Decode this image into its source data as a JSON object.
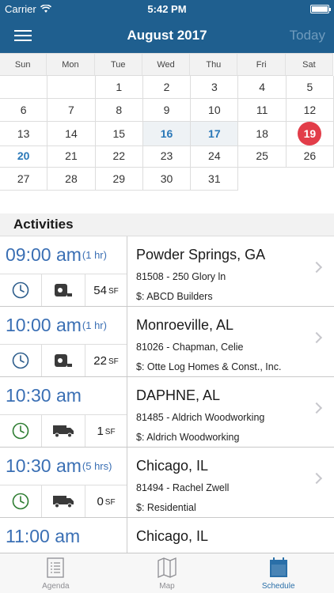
{
  "status": {
    "carrier": "Carrier",
    "time": "5:42 PM"
  },
  "nav": {
    "title": "August 2017",
    "today_label": "Today"
  },
  "calendar": {
    "weekdays": [
      "Sun",
      "Mon",
      "Tue",
      "Wed",
      "Thu",
      "Fri",
      "Sat"
    ],
    "weeks": [
      [
        "",
        "",
        "1",
        "2",
        "3",
        "4",
        "5"
      ],
      [
        "6",
        "7",
        "8",
        "9",
        "10",
        "11",
        "12"
      ],
      [
        "13",
        "14",
        "15",
        "16",
        "17",
        "18",
        "19"
      ],
      [
        "20",
        "21",
        "22",
        "23",
        "24",
        "25",
        "26"
      ],
      [
        "27",
        "28",
        "29",
        "30",
        "31",
        "",
        ""
      ]
    ],
    "highlighted_days": [
      "16",
      "17"
    ],
    "selected_day": "20",
    "today": "19",
    "today_color": "#e23d49",
    "accent_color": "#2a78b8"
  },
  "activities_header": "Activities",
  "activities": [
    {
      "time": "09:00 am",
      "duration": "(1 hr)",
      "icon_type": "tape-measure-icon",
      "quantity": "54",
      "unit": "SF",
      "city": "Powder Springs, GA",
      "job": "81508 - 250 Glory ln",
      "client": "$: ABCD Builders",
      "clock_color": "#2d5d8c"
    },
    {
      "time": "10:00 am",
      "duration": "(1 hr)",
      "icon_type": "tape-measure-icon",
      "quantity": "22",
      "unit": "SF",
      "city": "Monroeville, AL",
      "job": "81026 - Chapman, Celie",
      "client": "$: Otte Log Homes & Const., Inc.",
      "clock_color": "#2d5d8c"
    },
    {
      "time": "10:30 am",
      "duration": "",
      "icon_type": "truck-icon",
      "quantity": "1",
      "unit": "SF",
      "city": "DAPHNE, AL",
      "job": "81485 - Aldrich Woodworking",
      "client": "$: Aldrich Woodworking",
      "clock_color": "#2e7d32"
    },
    {
      "time": "10:30 am",
      "duration": "(5 hrs)",
      "icon_type": "truck-icon",
      "quantity": "0",
      "unit": "SF",
      "city": "Chicago, IL",
      "job": "81494 - Rachel Zwell",
      "client": "$: Residential",
      "clock_color": "#2e7d32"
    },
    {
      "time": "11:00 am",
      "duration": "",
      "icon_type": "",
      "quantity": "",
      "unit": "",
      "city": "Chicago, IL",
      "job": "",
      "client": "",
      "clock_color": "#2d5d8c"
    }
  ],
  "tabs": [
    {
      "label": "Agenda",
      "icon": "agenda-icon",
      "active": false
    },
    {
      "label": "Map",
      "icon": "map-icon",
      "active": false
    },
    {
      "label": "Schedule",
      "icon": "calendar-icon",
      "active": true
    }
  ]
}
